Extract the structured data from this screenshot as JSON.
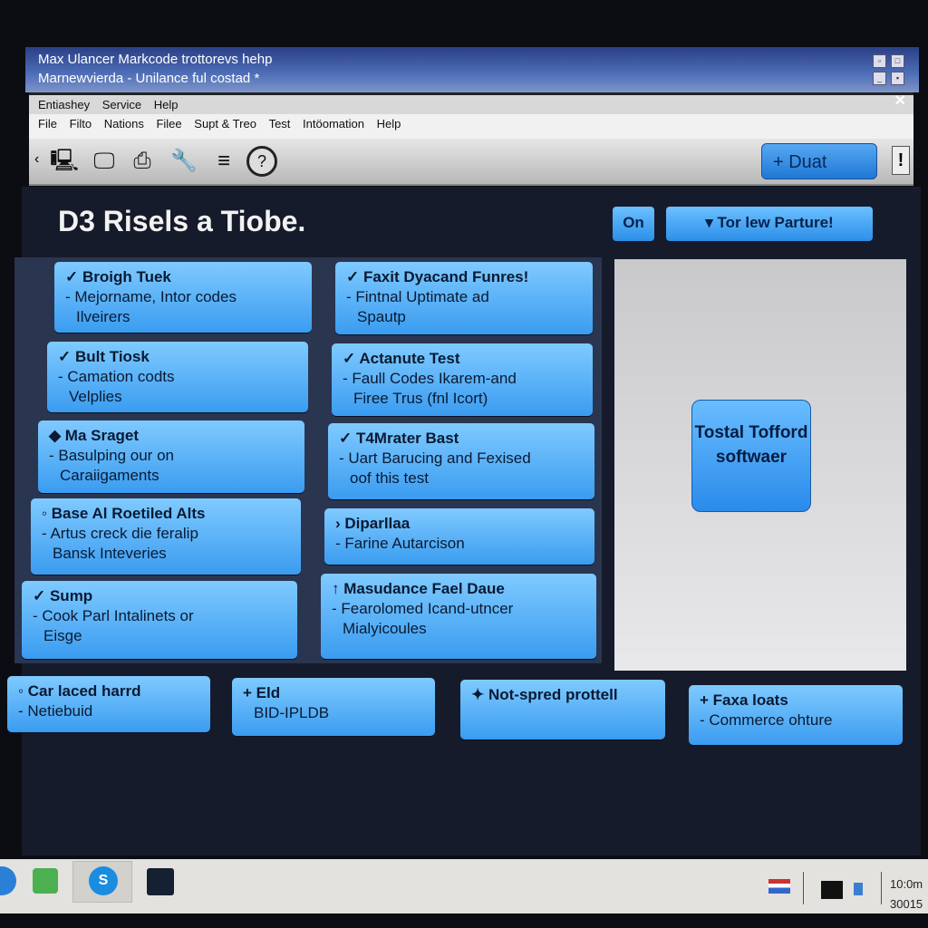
{
  "window": {
    "title": "Max Ulancer Markcode trottorevs hehp",
    "subtitle": "Marnewvierda - Unilance ful costad *"
  },
  "menu_primary": [
    "Entiashey",
    "Service",
    "Help"
  ],
  "menu_secondary": [
    "File",
    "Filto",
    "Nations",
    "Filee",
    "Supt & Treo",
    "Test",
    "Intöomation",
    "Help"
  ],
  "toolbar": {
    "icons": [
      "computer-icon",
      "monitor-icon",
      "printer-icon",
      "wrench-icon",
      "scanner-icon",
      "help-icon"
    ],
    "action_label": "+ Duat",
    "alert_label": "!"
  },
  "page": {
    "title": "D3 Risels a Tiobe.",
    "on_label": "On",
    "feature_label": "▾ Tor lew Parture!"
  },
  "col1": [
    {
      "title": "✓ Broigh Tuek",
      "lines": [
        "- Mejorname, Intor codes",
        "Ilveirers"
      ]
    },
    {
      "title": "✓ Bult Tiosk",
      "lines": [
        "- Camation codts",
        "Velplies"
      ]
    },
    {
      "title": "◆ Ma Sraget",
      "lines": [
        "- Basulping our on",
        "Caraiigaments"
      ]
    },
    {
      "title": "◦ Base Al Roetiled Alts",
      "lines": [
        "- Artus creck die feralip",
        "Bansk Inteveries"
      ]
    },
    {
      "title": "✓ Sump",
      "lines": [
        "- Cook Parl Intalinets or",
        "Eisge"
      ]
    }
  ],
  "col2": [
    {
      "title": "✓ Faxit Dyacand Funres!",
      "lines": [
        "- Fintnal Uptimate ad",
        "Spautp"
      ]
    },
    {
      "title": "✓ Actanute Test",
      "lines": [
        "- Faull Codes Ikarem-and",
        "Firee Trus (fnl Icort)"
      ]
    },
    {
      "title": "✓ T4Mrater Bast",
      "lines": [
        "- Uart Barucing and Fexised",
        "oof this test"
      ]
    },
    {
      "title": "› Diparllaa",
      "lines": [
        "- Farine Autarcison"
      ]
    },
    {
      "title": "↑ Masudance Fael Daue",
      "lines": [
        "- Fearolomed Icand-utncer",
        "Mialyicoules"
      ]
    }
  ],
  "panel": {
    "button_label": "Tostal Tofford softwaer"
  },
  "bottom": [
    {
      "title": "◦ Car laced harrd",
      "lines": [
        "- Netiebuid"
      ]
    },
    {
      "title": "+ Eld",
      "lines": [
        "BID-IPLDB"
      ]
    },
    {
      "title": "✦ Not-spred prottell",
      "lines": []
    },
    {
      "title": "+ Faxa loats",
      "lines": [
        "- Commerce ohture"
      ]
    }
  ],
  "taskbar": {
    "clock_time": "10:0m",
    "clock_date": "30015"
  }
}
